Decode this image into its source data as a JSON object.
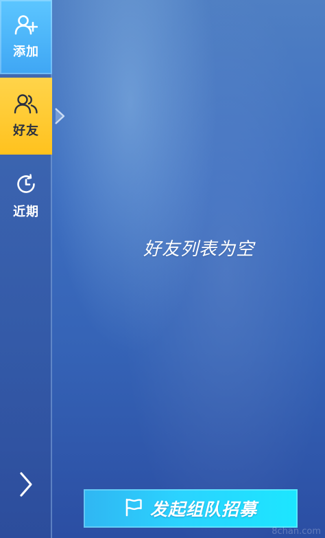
{
  "sidebar": {
    "tabs": [
      {
        "id": "add",
        "label": "添加",
        "icon": "add-user-icon"
      },
      {
        "id": "friends",
        "label": "好友",
        "icon": "friends-icon",
        "selected": true
      },
      {
        "id": "recent",
        "label": "近期",
        "icon": "recent-clock-icon"
      }
    ],
    "expand_icon": "chevron-right-icon"
  },
  "main": {
    "empty_message": "好友列表为空"
  },
  "recruit_button": {
    "label": "发起组队招募",
    "icon": "flag-icon"
  },
  "watermark": "8chan.com",
  "colors": {
    "add_tab": "#4db6fa",
    "friends_tab": "#ffc825",
    "recruit_button": "#2bd3ff",
    "background": "#3d6ec0"
  }
}
